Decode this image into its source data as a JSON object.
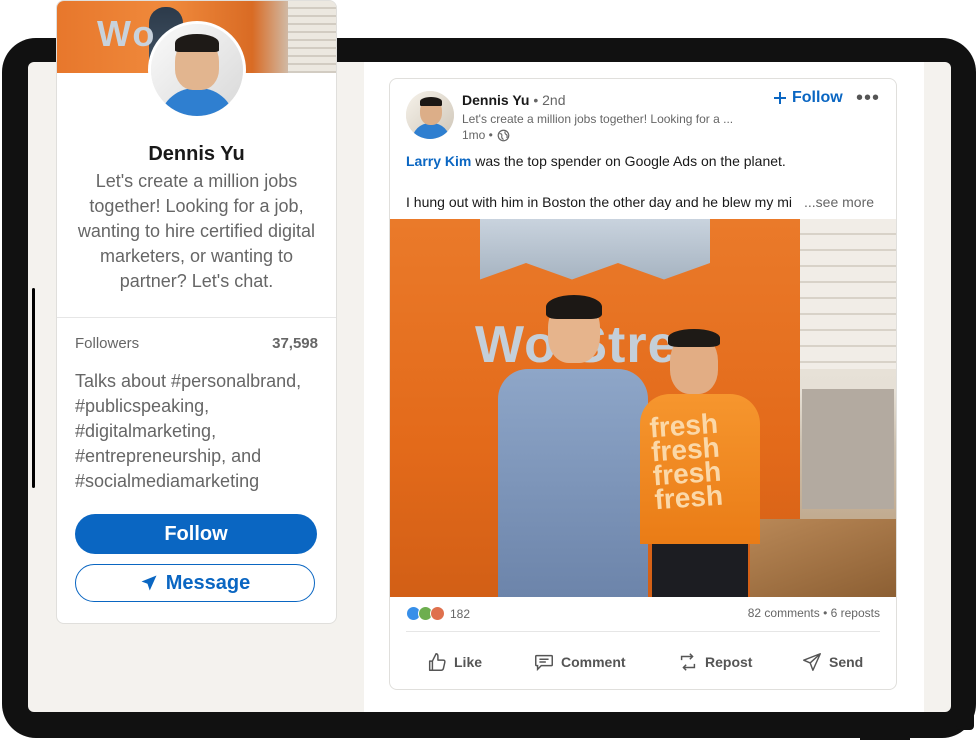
{
  "profile": {
    "cover_text": "Wo",
    "name": "Dennis Yu",
    "headline": "Let's create a million jobs together! Looking for a job, wanting to hire certified digital marketers, or wanting to partner? Let's chat.",
    "followers_label": "Followers",
    "followers_count": "37,598",
    "talks_about": "Talks about #personalbrand, #publicspeaking, #digitalmarketing, #entrepreneurship, and #socialmediamarketing",
    "follow_label": "Follow",
    "message_label": "Message"
  },
  "post": {
    "author": "Dennis Yu",
    "degree": " • 2nd",
    "headline": "Let's create a million jobs together! Looking for a ...",
    "time": "1mo •",
    "follow_label": "Follow",
    "mention": "Larry Kim",
    "text_line1_rest": " was the top spender on Google Ads on the planet.",
    "text_line2": "I hung out with him in Boston the other day and he blew my mi",
    "see_more": "...see more",
    "photo_logo_text": "Wo    Stre",
    "photo_shirt_text": "fresh\nfresh\nfresh\nfresh",
    "reaction_count": "182",
    "comments_reposts": "82 comments • 6 reposts",
    "actions": {
      "like": "Like",
      "comment": "Comment",
      "repost": "Repost",
      "send": "Send"
    }
  },
  "colors": {
    "brand_blue": "#0a66c2",
    "page_bg": "#f4f2ee"
  }
}
